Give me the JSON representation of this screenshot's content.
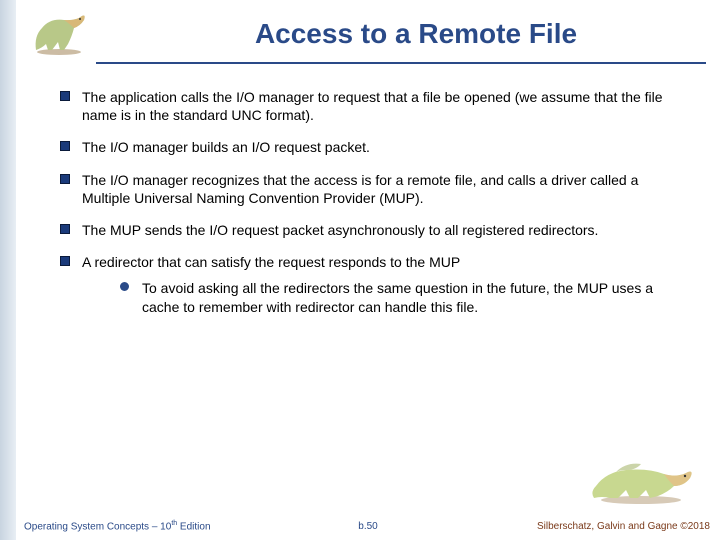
{
  "title": "Access to a Remote File",
  "bullets": [
    "The application calls the I/O manager to request that a file be opened (we assume that the file name is in the standard UNC format).",
    "The I/O manager builds an I/O request packet.",
    "The I/O manager recognizes that the access is for a remote file, and calls a driver called a Multiple Universal Naming Convention Provider (MUP).",
    "The MUP sends the I/O request packet asynchronously to all registered redirectors.",
    "A redirector that can satisfy the request responds to the MUP"
  ],
  "sub_bullet": "To avoid asking all the redirectors the same question in the future, the MUP uses a cache to remember with redirector can handle this file.",
  "footer": {
    "left_prefix": "Operating System Concepts – 10",
    "left_suffix": " Edition",
    "left_sup": "th",
    "center": "b.50",
    "right": "Silberschatz, Galvin and Gagne ©2018"
  }
}
